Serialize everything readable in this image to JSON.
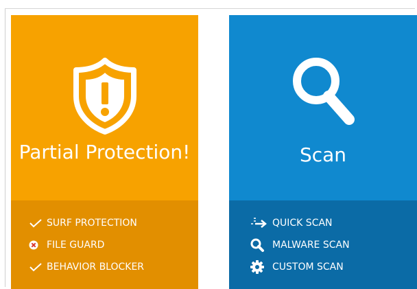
{
  "colors": {
    "protection_top": "#F7A200",
    "protection_bottom": "#E28F00",
    "scan_top": "#1089CF",
    "scan_bottom": "#0B6BA6"
  },
  "protection_tile": {
    "icon": "shield-exclamation-icon",
    "title": "Partial Protection!",
    "items": [
      {
        "icon": "checkmark-icon",
        "label": "SURF PROTECTION"
      },
      {
        "icon": "error-x-icon",
        "label": "FILE GUARD"
      },
      {
        "icon": "checkmark-icon",
        "label": "BEHAVIOR BLOCKER"
      }
    ]
  },
  "scan_tile": {
    "icon": "magnifier-icon",
    "title": "Scan",
    "items": [
      {
        "icon": "quick-scan-arrows-icon",
        "label": "QUICK SCAN"
      },
      {
        "icon": "search-icon",
        "label": "MALWARE SCAN"
      },
      {
        "icon": "gear-icon",
        "label": "CUSTOM SCAN"
      }
    ]
  }
}
